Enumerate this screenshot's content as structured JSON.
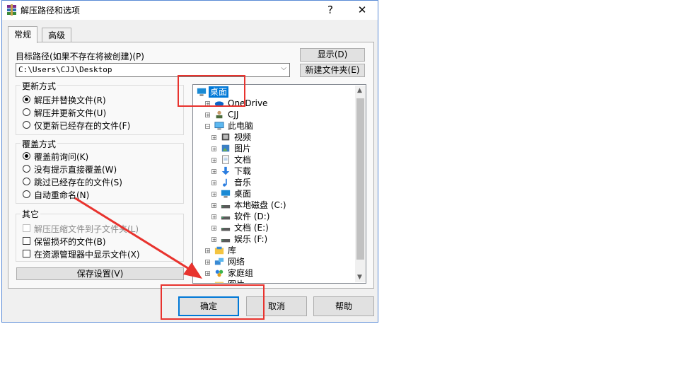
{
  "dialog": {
    "title": "解压路径和选项",
    "help_btn": "?",
    "close_btn": "✕"
  },
  "tabs": [
    {
      "label": "常规",
      "active": true
    },
    {
      "label": "高级",
      "active": false
    }
  ],
  "dest": {
    "label": "目标路径(如果不存在将被创建)(P)",
    "value": "C:\\Users\\CJJ\\Desktop",
    "show_btn": "显示(D)",
    "newfolder_btn": "新建文件夹(E)"
  },
  "update_group": {
    "title": "更新方式",
    "options": [
      {
        "label": "解压并替换文件(R)",
        "selected": true
      },
      {
        "label": "解压并更新文件(U)",
        "selected": false
      },
      {
        "label": "仅更新已经存在的文件(F)",
        "selected": false
      }
    ]
  },
  "overwrite_group": {
    "title": "覆盖方式",
    "options": [
      {
        "label": "覆盖前询问(K)",
        "selected": true
      },
      {
        "label": "没有提示直接覆盖(W)",
        "selected": false
      },
      {
        "label": "跳过已经存在的文件(S)",
        "selected": false
      },
      {
        "label": "自动重命名(N)",
        "selected": false
      }
    ]
  },
  "misc_group": {
    "title": "其它",
    "options": [
      {
        "label": "解压压缩文件到子文件夹(L)",
        "checked": false,
        "enabled": false
      },
      {
        "label": "保留损坏的文件(B)",
        "checked": false,
        "enabled": true
      },
      {
        "label": "在资源管理器中显示文件(X)",
        "checked": false,
        "enabled": true
      }
    ]
  },
  "save_settings_btn": "保存设置(V)",
  "tree": {
    "items": [
      {
        "label": "桌面",
        "selected": true,
        "icon": "desktop-icon"
      },
      {
        "label": "OneDrive",
        "icon": "onedrive-icon"
      },
      {
        "label": "CJJ",
        "icon": "user-icon"
      },
      {
        "label": "此电脑",
        "icon": "computer-icon"
      },
      {
        "label": "视频",
        "icon": "video-icon"
      },
      {
        "label": "图片",
        "icon": "picture-icon"
      },
      {
        "label": "文档",
        "icon": "document-icon"
      },
      {
        "label": "下载",
        "icon": "download-icon"
      },
      {
        "label": "音乐",
        "icon": "music-icon"
      },
      {
        "label": "桌面",
        "icon": "desktop-icon"
      },
      {
        "label": "本地磁盘 (C:)",
        "icon": "drive-icon"
      },
      {
        "label": "软件 (D:)",
        "icon": "drive-icon"
      },
      {
        "label": "文档 (E:)",
        "icon": "drive-icon"
      },
      {
        "label": "娱乐 (F:)",
        "icon": "drive-icon"
      },
      {
        "label": "库",
        "icon": "library-icon"
      },
      {
        "label": "网络",
        "icon": "network-icon"
      },
      {
        "label": "家庭组",
        "icon": "homegroup-icon"
      },
      {
        "label": "图片",
        "icon": "folder-icon"
      }
    ]
  },
  "footer": {
    "ok": "确定",
    "cancel": "取消",
    "help": "帮助"
  },
  "colors": {
    "annotation": "#e8332e",
    "accent": "#0078d7"
  }
}
